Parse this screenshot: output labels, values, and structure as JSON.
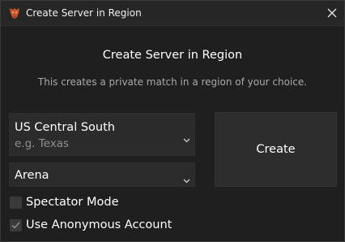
{
  "window": {
    "title": "Create Server in Region",
    "icon": "app-logo-icon",
    "close_icon": "close-icon"
  },
  "header": {
    "heading": "Create Server in Region",
    "description": "This creates a private match in a region of your choice."
  },
  "region_select": {
    "value": "US Central South",
    "placeholder": "e.g. Texas",
    "icon": "chevron-down-icon"
  },
  "mode_select": {
    "value": "Arena",
    "icon": "chevron-down-icon"
  },
  "create_button": {
    "label": "Create"
  },
  "options": [
    {
      "label": "Spectator Mode",
      "checked": false
    },
    {
      "label": "Use Anonymous Account",
      "checked": true
    }
  ],
  "colors": {
    "background": "#1f1f1f",
    "titlebar": "#262626",
    "control": "#2b2b2b",
    "subtext": "#a9a9a9",
    "placeholder": "#8f8f8f"
  }
}
